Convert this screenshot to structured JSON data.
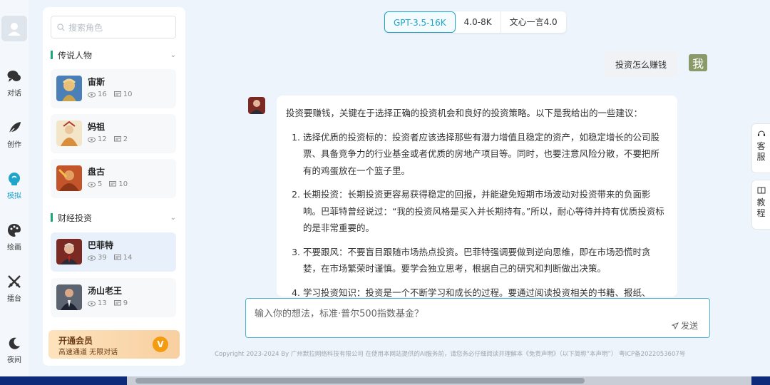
{
  "nav": {
    "items": [
      {
        "label": "对话",
        "icon": "chat-icon"
      },
      {
        "label": "创作",
        "icon": "feather-icon"
      },
      {
        "label": "模拟",
        "icon": "bulb-icon"
      },
      {
        "label": "绘画",
        "icon": "palette-icon"
      },
      {
        "label": "擂台",
        "icon": "swords-icon"
      },
      {
        "label": "夜间",
        "icon": "moon-icon"
      }
    ],
    "active": "模拟"
  },
  "search": {
    "placeholder": "搜索角色"
  },
  "groups": [
    {
      "title": "传说人物",
      "roles": [
        {
          "name": "宙斯",
          "views": "16",
          "chats": "10"
        },
        {
          "name": "妈祖",
          "views": "12",
          "chats": "2"
        },
        {
          "name": "盘古",
          "views": "5",
          "chats": "10"
        }
      ]
    },
    {
      "title": "财经投资",
      "roles": [
        {
          "name": "巴菲特",
          "views": "39",
          "chats": "14"
        },
        {
          "name": "汤山老王",
          "views": "13",
          "chats": "9"
        }
      ]
    }
  ],
  "vip": {
    "title": "开通会员",
    "subtitle": "高速通道 无限对话",
    "badge": "V"
  },
  "model_tabs": [
    "GPT-3.5-16K",
    "4.0-8K",
    "文心一言4.0"
  ],
  "active_model": "GPT-3.5-16K",
  "user_message": "投资怎么赚钱",
  "user_avatar_text": "我",
  "bot": {
    "intro": "投资要赚钱，关键在于选择正确的投资机会和良好的投资策略。以下是我给出的一些建议：",
    "points": [
      "选择优质的投资标的：投资者应该选择那些有潜力增值且稳定的资产，如稳定增长的公司股票、具备竞争力的行业基金或者优质的房地产项目等。同时，也要注意风险分散，不要把所有的鸡蛋放在一个篮子里。",
      "长期投资：长期投资更容易获得稳定的回报，并能避免短期市场波动对投资带来的负面影响。巴菲特曾经说过：“我的投资风格是买入并长期持有。”所以，耐心等待并持有优质投资标的是非常重要的。",
      "不要跟风：不要盲目跟随市场热点投资。巴菲特强调要做到逆向思维，即在市场恐慌时贪婪，在市场繁荣时谨慎。要学会独立思考，根据自己的研究和判断做出决策。",
      "学习投资知识：投资是一个不断学习和成长的过程。要通过阅读投资相关的书籍、报纸、"
    ]
  },
  "input": {
    "placeholder": "输入你的想法，标准·普尔500指数基金？",
    "send_label": "发送"
  },
  "footer": "Copyright 2023-2024 By 广州默拉网络科技有限公司 在使用本网站提供的AI服务前，请您务必仔细阅读并理解本《免责声明》（以下简称“本声明”）     粤ICP备2022053607号",
  "float": [
    {
      "label": "客服",
      "icon": "headset-icon"
    },
    {
      "label": "教程",
      "icon": "book-icon"
    }
  ]
}
